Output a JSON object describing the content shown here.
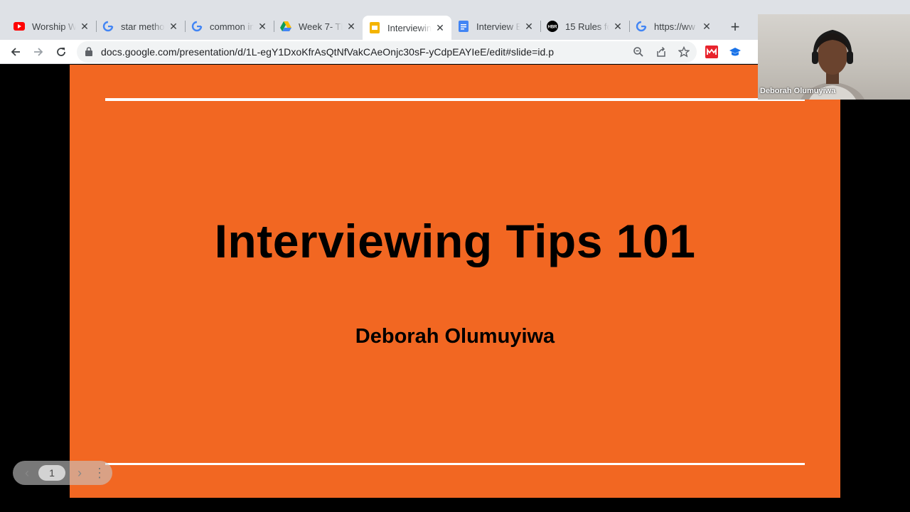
{
  "browser": {
    "tabs": [
      {
        "title": "Worship Wa",
        "icon": "youtube-icon",
        "active": false
      },
      {
        "title": "star metho",
        "icon": "google-icon",
        "active": false
      },
      {
        "title": "common in",
        "icon": "google-icon",
        "active": false
      },
      {
        "title": "Week 7- Th",
        "icon": "drive-icon",
        "active": false
      },
      {
        "title": "Interviewin",
        "icon": "slides-icon",
        "active": true
      },
      {
        "title": "Interview B",
        "icon": "docs-icon",
        "active": false
      },
      {
        "title": "15 Rules fo",
        "icon": "hbr-icon",
        "active": false
      },
      {
        "title": "https://ww",
        "icon": "google-icon",
        "active": false
      }
    ],
    "url": "docs.google.com/presentation/d/1L-egY1DxoKfrAsQtNfVakCAeOnjc30sF-yCdpEAYIeE/edit#slide=id.p"
  },
  "slide": {
    "title": "Interviewing Tips 101",
    "subtitle": "Deborah Olumuyiwa",
    "background": "#f26722"
  },
  "slide_nav": {
    "current_page": "1"
  },
  "webcam": {
    "participant_name": "Deborah Olumuyiwa"
  }
}
